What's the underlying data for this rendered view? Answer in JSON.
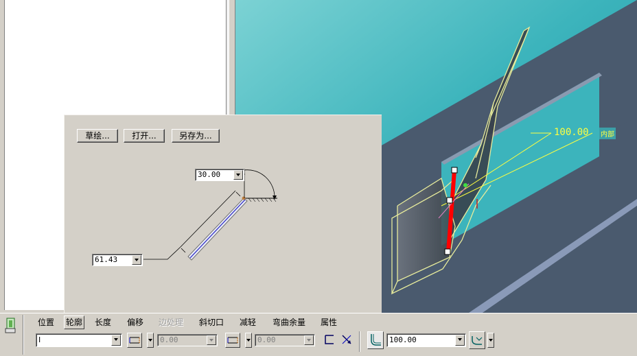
{
  "profile_panel": {
    "sketch_button": "草绘...",
    "open_button": "打开...",
    "saveas_button": "另存为...",
    "angle_value": "30.00",
    "length_value": "61.43"
  },
  "viewport": {
    "dimension_value": "100.00",
    "dimension_tag": "内部"
  },
  "dashboard": {
    "tabs": [
      "位置",
      "轮廓",
      "长度",
      "偏移",
      "边处理",
      "斜切口",
      "减轻",
      "弯曲余量",
      "属性"
    ],
    "active_tab": "轮廓",
    "disabled_tab": "边处理",
    "shape_select": "I",
    "offset_value_1": "0.00",
    "offset_value_2": "0.00",
    "bend_radius": "100.00"
  },
  "colors": {
    "viewport_bg": "#3cb4bc",
    "part_face": "#4a5a6e",
    "preview_outline": "#e8ec9c",
    "attach_edge": "#ff0000",
    "dimension": "#ffff40"
  }
}
